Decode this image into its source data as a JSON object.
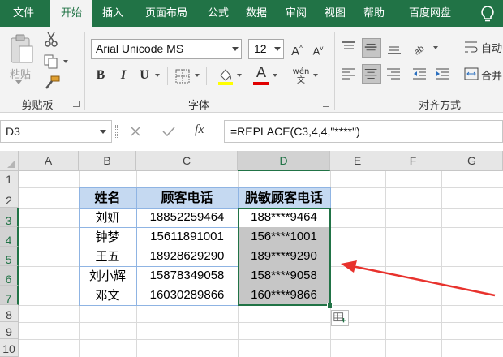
{
  "tabs": [
    {
      "label": "文件"
    },
    {
      "label": "开始"
    },
    {
      "label": "插入"
    },
    {
      "label": "页面布局"
    },
    {
      "label": "公式"
    },
    {
      "label": "数据"
    },
    {
      "label": "审阅"
    },
    {
      "label": "视图"
    },
    {
      "label": "帮助"
    },
    {
      "label": "百度网盘"
    }
  ],
  "ribbon": {
    "clipboard": {
      "paste_label": "粘贴",
      "group_label": "剪贴板"
    },
    "font": {
      "font_name": "Arial Unicode MS",
      "font_size": "12",
      "bold": "B",
      "italic": "I",
      "underline": "U",
      "font_color_glyph": "A",
      "group_label": "字体"
    },
    "alignment": {
      "wrap_label": "自动",
      "merge_label": "合并",
      "group_label": "对齐方式"
    }
  },
  "formula_bar": {
    "name_box": "D3",
    "fx": "fx",
    "formula": "=REPLACE(C3,4,4,\"****\")"
  },
  "grid": {
    "columns": [
      "A",
      "B",
      "C",
      "D",
      "E",
      "F",
      "G"
    ],
    "rows": [
      "1",
      "2",
      "3",
      "4",
      "5",
      "6",
      "7",
      "8",
      "9",
      "10"
    ],
    "headers": [
      "姓名",
      "顾客电话",
      "脱敏顾客电话"
    ],
    "data": [
      [
        "刘妍",
        "18852259464",
        "188****9464"
      ],
      [
        "钟梦",
        "15611891001",
        "156****1001"
      ],
      [
        "王五",
        "18928629290",
        "189****9290"
      ],
      [
        "刘小辉",
        "15878349058",
        "158****9058"
      ],
      [
        "邓文",
        "16030289866",
        "160****9866"
      ]
    ]
  },
  "colors": {
    "ribbon_green": "#217346",
    "header_fill": "#c5d9f1",
    "arrow": "#e8322d"
  }
}
